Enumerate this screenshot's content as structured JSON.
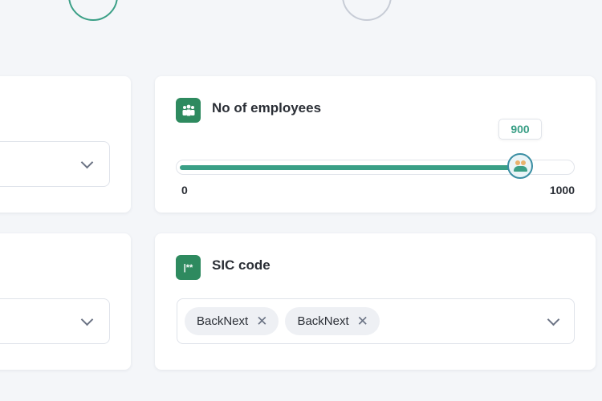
{
  "employees": {
    "title": "No of employees",
    "min_label": "0",
    "max_label": "1000",
    "min": 0,
    "max": 1000,
    "value": 900,
    "value_label": "900"
  },
  "sic": {
    "title": "SIC code",
    "icon_text": "|**",
    "tags": [
      {
        "label": "BackNext"
      },
      {
        "label": "BackNext"
      }
    ]
  },
  "icons": {
    "employees_icon": "people-group-icon",
    "sic_icon": "asterisk-code-icon",
    "thumb_icon": "people-icon",
    "dropdown": "chevron-down-icon",
    "remove": "close-icon"
  },
  "colors": {
    "accent": "#3a9f86",
    "icon_bg": "#2e8a5f",
    "background": "#f4f6f9"
  }
}
